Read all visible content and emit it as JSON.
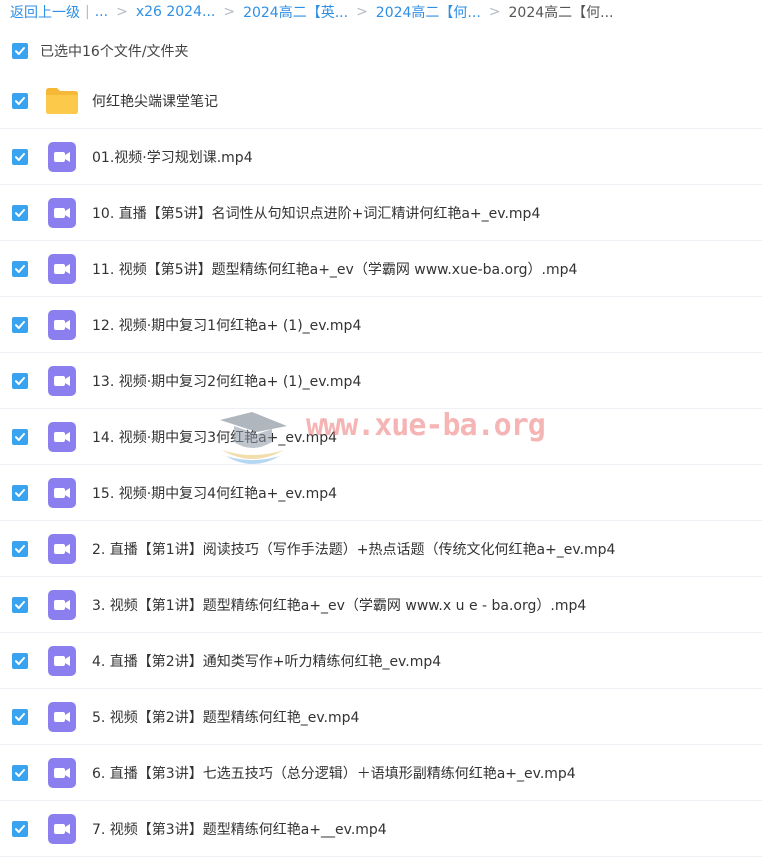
{
  "breadcrumb": {
    "back": "返回上一级",
    "ellipsis": "...",
    "items": [
      "x26 2024...",
      "2024高二【英...",
      "2024高二【何...",
      "2024高二【何..."
    ]
  },
  "selection": {
    "text": "已选中16个文件/文件夹"
  },
  "files": [
    {
      "name": "何红艳尖端课堂笔记",
      "type": "folder-icon"
    },
    {
      "name": "01.视频·学习规划课.mp4",
      "type": "video-icon"
    },
    {
      "name": "10. 直播【第5讲】名词性从句知识点进阶+词汇精讲何红艳a+_ev.mp4",
      "type": "video-icon"
    },
    {
      "name": "11. 视频【第5讲】题型精练何红艳a+_ev（学霸网 www.xue-ba.org）.mp4",
      "type": "video-icon"
    },
    {
      "name": "12. 视频·期中复习1何红艳a+ (1)_ev.mp4",
      "type": "video-icon"
    },
    {
      "name": "13. 视频·期中复习2何红艳a+ (1)_ev.mp4",
      "type": "video-icon"
    },
    {
      "name": "14. 视频·期中复习3何红艳a+_ev.mp4",
      "type": "video-icon"
    },
    {
      "name": "15. 视频·期中复习4何红艳a+_ev.mp4",
      "type": "video-icon"
    },
    {
      "name": "2. 直播【第1讲】阅读技巧（写作手法题）+热点话题（传统文化何红艳a+_ev.mp4",
      "type": "video-icon"
    },
    {
      "name": "3. 视频【第1讲】题型精练何红艳a+_ev（学霸网 www.x u e - ba.org）.mp4",
      "type": "video-icon"
    },
    {
      "name": "4. 直播【第2讲】通知类写作+听力精练何红艳_ev.mp4",
      "type": "video-icon"
    },
    {
      "name": "5. 视频【第2讲】题型精练何红艳_ev.mp4",
      "type": "video-icon"
    },
    {
      "name": "6. 直播【第3讲】七选五技巧（总分逻辑）＋语填形副精练何红艳a+_ev.mp4",
      "type": "video-icon"
    },
    {
      "name": "7. 视频【第3讲】题型精练何红艳a+__ev.mp4",
      "type": "video-icon"
    }
  ],
  "watermark": {
    "text": "www.xue-ba.org"
  },
  "colors": {
    "link": "#2f8fe5",
    "checkbox": "#3aa3ef",
    "video_icon": "#8b7ff0",
    "folder": "#fcc94a"
  }
}
